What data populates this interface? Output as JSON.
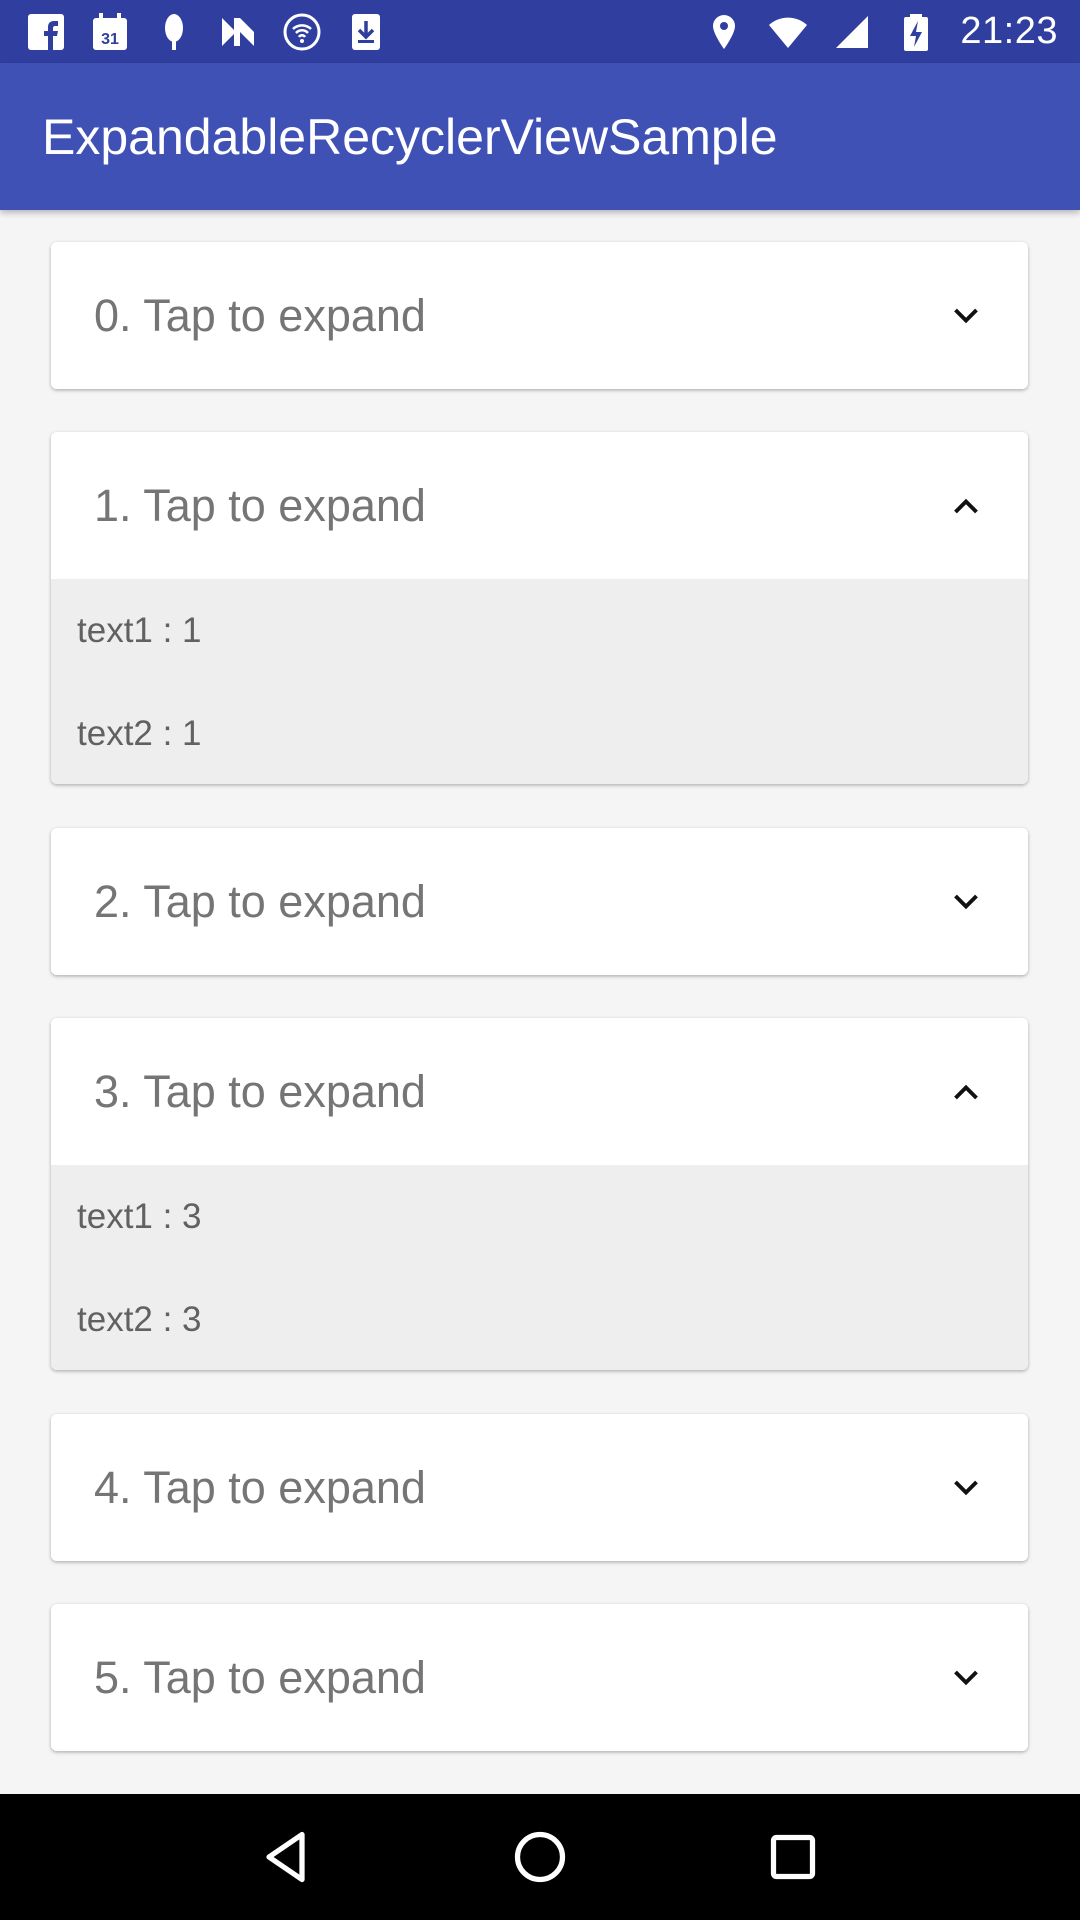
{
  "status_bar": {
    "time": "21:23",
    "left_icons": [
      "facebook-icon",
      "calendar-icon",
      "nature-icon",
      "n-logo-icon",
      "wifi-circle-icon",
      "download-icon"
    ],
    "calendar_day": "31",
    "right_icons": [
      "location-icon",
      "wifi-icon",
      "signal-icon",
      "battery-charging-icon"
    ]
  },
  "app_bar": {
    "title": "ExpandableRecyclerViewSample"
  },
  "list": {
    "items": [
      {
        "title": "0. Tap to expand",
        "expanded": false
      },
      {
        "title": "1. Tap to expand",
        "expanded": true,
        "children": [
          "text1 : 1",
          "text2 : 1"
        ]
      },
      {
        "title": "2. Tap to expand",
        "expanded": false
      },
      {
        "title": "3. Tap to expand",
        "expanded": true,
        "children": [
          "text1 : 3",
          "text2 : 3"
        ]
      },
      {
        "title": "4. Tap to expand",
        "expanded": false
      },
      {
        "title": "5. Tap to expand",
        "expanded": false
      }
    ]
  },
  "colors": {
    "status_bar": "#303F9F",
    "primary": "#3F51B5",
    "background": "#F5F5F5",
    "expanded_body": "#EEEEEE"
  },
  "nav_bar": {
    "buttons": [
      "back-icon",
      "home-icon",
      "recents-icon"
    ]
  }
}
